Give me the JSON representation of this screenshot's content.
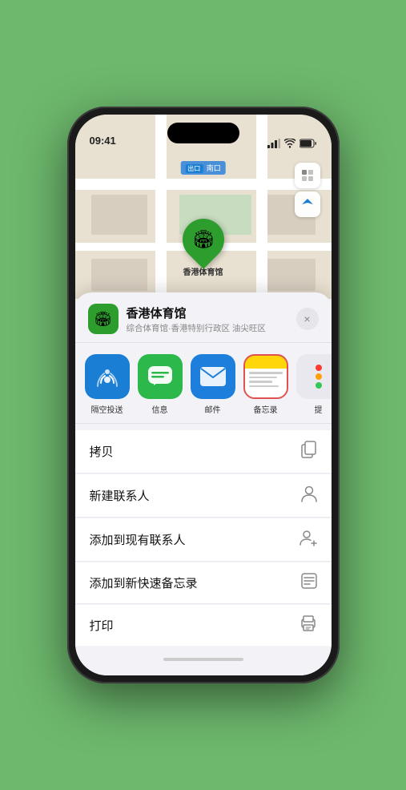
{
  "status": {
    "time": "09:41",
    "location_arrow": true
  },
  "map": {
    "label": "南口",
    "label_prefix": "出口"
  },
  "pin": {
    "label": "香港体育馆",
    "emoji": "🏟"
  },
  "sheet": {
    "name": "香港体育馆",
    "subtitle": "综合体育馆·香港特别行政区 油尖旺区",
    "close_label": "×"
  },
  "apps": [
    {
      "id": "airdrop",
      "label": "隔空投送",
      "emoji": "📡"
    },
    {
      "id": "messages",
      "label": "信息",
      "emoji": "💬"
    },
    {
      "id": "mail",
      "label": "邮件",
      "emoji": "✉️"
    },
    {
      "id": "notes",
      "label": "备忘录",
      "type": "notes"
    },
    {
      "id": "more",
      "label": "提",
      "type": "more"
    }
  ],
  "actions": [
    {
      "label": "拷贝",
      "icon": "copy"
    },
    {
      "label": "新建联系人",
      "icon": "person"
    },
    {
      "label": "添加到现有联系人",
      "icon": "person-add"
    },
    {
      "label": "添加到新快速备忘录",
      "icon": "note"
    },
    {
      "label": "打印",
      "icon": "print"
    }
  ]
}
